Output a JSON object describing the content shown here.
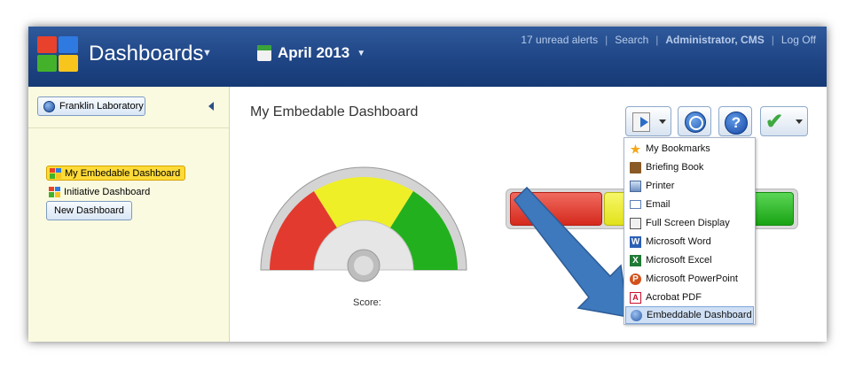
{
  "header": {
    "app_title": "Dashboards",
    "period": "April 2013",
    "links": {
      "alerts": "17 unread alerts",
      "search": "Search",
      "user": "Administrator, CMS",
      "logoff": "Log Off"
    },
    "separator": "|"
  },
  "sidebar": {
    "org_button": "Franklin Laboratory",
    "items": [
      {
        "label": "My Embedable Dashboard",
        "active": true
      },
      {
        "label": "Initiative Dashboard",
        "active": false
      }
    ],
    "new_button": "New Dashboard"
  },
  "main": {
    "title": "My Embedable Dashboard",
    "toolbar": {
      "help_glyph": "?",
      "check_glyph": "✔"
    },
    "gauge": {
      "label": "Score:",
      "colors": [
        "#e23a2e",
        "#efef28",
        "#23b01e"
      ]
    },
    "bar": {
      "colors": [
        "#e23a2e",
        "#efef28",
        "#23b01e"
      ]
    },
    "menu": {
      "items": [
        {
          "label": "My Bookmarks",
          "icon": "star-icon"
        },
        {
          "label": "Briefing Book",
          "icon": "book-icon"
        },
        {
          "label": "Printer",
          "icon": "printer-icon"
        },
        {
          "label": "Email",
          "icon": "email-icon"
        },
        {
          "label": "Full Screen Display",
          "icon": "fullscreen-icon"
        },
        {
          "label": "Microsoft Word",
          "icon": "word-icon"
        },
        {
          "label": "Microsoft Excel",
          "icon": "excel-icon"
        },
        {
          "label": "Microsoft PowerPoint",
          "icon": "powerpoint-icon"
        },
        {
          "label": "Acrobat PDF",
          "icon": "pdf-icon"
        },
        {
          "label": "Embeddable Dashboard",
          "icon": "embed-icon",
          "highlighted": true
        }
      ]
    }
  },
  "colors": {
    "header": "#1f4585",
    "sidebar": "#fafae0",
    "active_item": "#ffdb38",
    "arrow": "#3f79bd",
    "menu_highlight": "#cfe0f6"
  }
}
